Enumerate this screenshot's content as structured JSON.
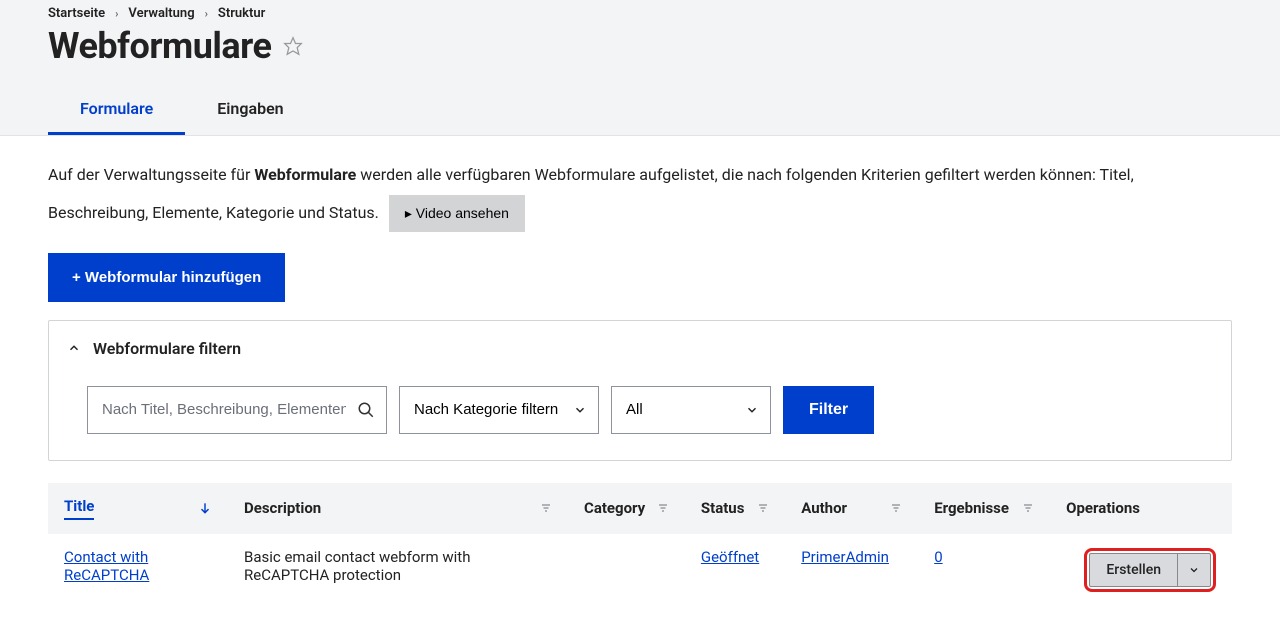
{
  "breadcrumb": {
    "items": [
      "Startseite",
      "Verwaltung",
      "Struktur"
    ]
  },
  "page": {
    "title": "Webformulare"
  },
  "tabs": {
    "items": [
      {
        "label": "Formulare",
        "active": true
      },
      {
        "label": "Eingaben",
        "active": false
      }
    ]
  },
  "intro": {
    "prefix": "Auf der Verwaltungsseite für ",
    "strong": "Webformulare",
    "suffix": " werden alle verfügbaren Webformulare aufgelistet, die nach folgenden Kriterien gefiltert werden können: Titel, Beschreibung, Elemente, Kategorie und Status.",
    "video_btn": "▸ Video ansehen"
  },
  "add_btn": "+ Webformular hinzufügen",
  "filter": {
    "title": "Webformulare filtern",
    "search_placeholder": "Nach Titel, Beschreibung, Elementen filtern",
    "category_label": "Nach Kategorie filtern",
    "status_label": "All",
    "submit": "Filter"
  },
  "table": {
    "headers": {
      "title": "Title",
      "description": "Description",
      "category": "Category",
      "status": "Status",
      "author": "Author",
      "results": "Ergebnisse",
      "operations": "Operations"
    },
    "rows": [
      {
        "title": "Contact with ReCAPTCHA",
        "description": "Basic email contact webform with ReCAPTCHA protection",
        "category": "",
        "status": "Geöffnet",
        "author": "PrimerAdmin",
        "results": "0",
        "op": "Erstellen"
      }
    ]
  }
}
